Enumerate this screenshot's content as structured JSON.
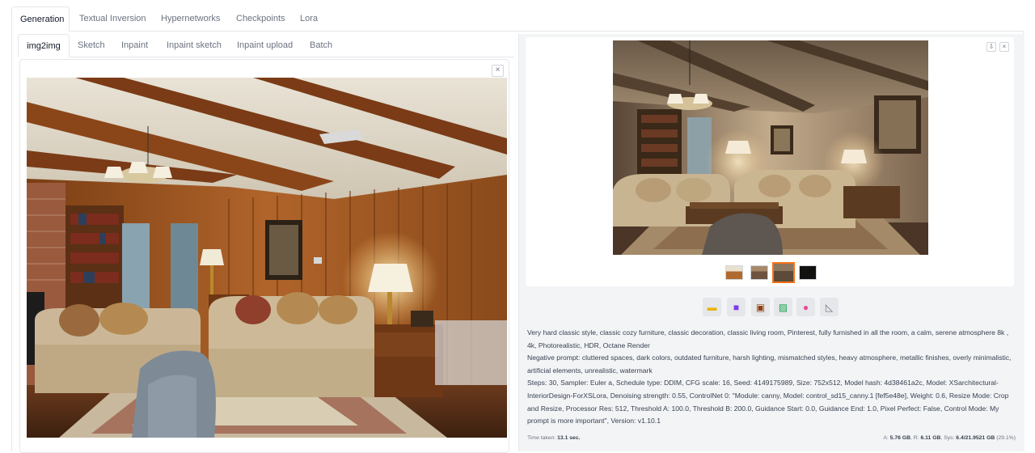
{
  "main_tabs": [
    "Generation",
    "Textual Inversion",
    "Hypernetworks",
    "Checkpoints",
    "Lora"
  ],
  "sub_tabs": [
    "img2img",
    "Sketch",
    "Inpaint",
    "Inpaint sketch",
    "Inpaint upload",
    "Batch"
  ],
  "input_image": {
    "close_label": "×"
  },
  "output_gallery": {
    "download_label": "⇩",
    "close_label": "×",
    "thumbnail_count": 4,
    "selected_thumbnail": 3
  },
  "tool_buttons": [
    "folder-icon",
    "save-icon",
    "zip-icon",
    "image-send-icon",
    "palette-icon",
    "ruler-icon"
  ],
  "generation_info": {
    "prompt": "Very hard classic style, classic cozy furniture, classic decoration, classic living room, Pinterest, fully furnished in all the room, a calm, serene atmosphere 8k , 4k, Photorealistic, HDR, Octane Render",
    "negative_prompt": "Negative prompt: cluttered spaces, dark colors, outdated furniture, harsh lighting, mismatched styles, heavy atmosphere, metallic finishes, overly minimalistic, artificial elements, unrealistic, watermark",
    "params": "Steps: 30, Sampler: Euler a, Schedule type: DDIM, CFG scale: 16, Seed: 4149175989, Size: 752x512, Model hash: 4d38461a2c, Model: XSarchitectural-InteriorDesign-ForXSLora, Denoising strength: 0.55, ControlNet 0: \"Module: canny, Model: control_sd15_canny.1 [fef5e48e], Weight: 0.6, Resize Mode: Crop and Resize, Processor Res: 512, Threshold A: 100.0, Threshold B: 200.0, Guidance Start: 0.0, Guidance End: 1.0, Pixel Perfect: False, Control Mode: My prompt is more important\", Version: v1.10.1"
  },
  "timing": {
    "label": "Time taken:",
    "value": "13.1 sec.",
    "a_label": "A:",
    "a_value": "5.76 GB",
    "r_label": "R:",
    "r_value": "6.11 GB",
    "sys_label": "Sys:",
    "sys_value": "6.4/21.9521 GB",
    "sys_pct": "(29.1%)"
  },
  "colors": {
    "accent": "#f97316",
    "panel_bg": "#f3f4f6",
    "border": "#e5e7eb"
  }
}
